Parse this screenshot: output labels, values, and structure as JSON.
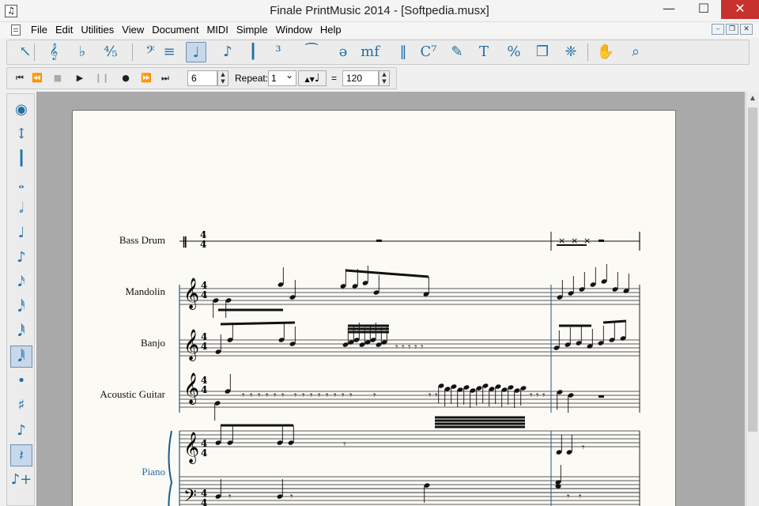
{
  "window": {
    "title": "Finale PrintMusic 2014 - [Softpedia.musx]",
    "minimize": "—",
    "maximize": "☐",
    "close": "✕"
  },
  "menu": {
    "items": [
      "File",
      "Edit",
      "Utilities",
      "View",
      "Document",
      "MIDI",
      "Simple",
      "Window",
      "Help"
    ],
    "mdi": [
      "–",
      "❐",
      "✕"
    ]
  },
  "toolbar": {
    "tools": [
      {
        "name": "selection-tool-icon",
        "glyph": "↖"
      },
      {
        "name": "staff-tool-icon",
        "glyph": "𝄞"
      },
      {
        "name": "key-signature-tool-icon",
        "glyph": "♭"
      },
      {
        "name": "time-signature-tool-icon",
        "glyph": "⅘"
      },
      {
        "name": "clef-tool-icon",
        "glyph": "𝄢"
      },
      {
        "name": "measure-tool-icon",
        "glyph": "≡"
      },
      {
        "name": "simple-entry-tool-icon",
        "glyph": "♩"
      },
      {
        "name": "speedy-entry-tool-icon",
        "glyph": "♪"
      },
      {
        "name": "tuplet-tool-icon",
        "glyph": "┃"
      },
      {
        "name": "triplet-tool-icon",
        "glyph": "³"
      },
      {
        "name": "smart-shape-tool-icon",
        "glyph": "⁀"
      },
      {
        "name": "articulation-tool-icon",
        "glyph": "ə"
      },
      {
        "name": "expression-tool-icon",
        "glyph": "mf"
      },
      {
        "name": "repeat-tool-icon",
        "glyph": "‖"
      },
      {
        "name": "chord-tool-icon",
        "glyph": "C⁷"
      },
      {
        "name": "lyrics-tool-icon",
        "glyph": "✎"
      },
      {
        "name": "text-tool-icon",
        "glyph": "T"
      },
      {
        "name": "resize-tool-icon",
        "glyph": "%"
      },
      {
        "name": "page-layout-tool-icon",
        "glyph": "❐"
      },
      {
        "name": "graphics-tool-icon",
        "glyph": "❈"
      },
      {
        "name": "hand-grabber-tool-icon",
        "glyph": "✋"
      },
      {
        "name": "zoom-tool-icon",
        "glyph": "⌕"
      }
    ]
  },
  "playback": {
    "buttons": [
      "⏮",
      "⏪",
      "■",
      "▶",
      "❙❙",
      "●",
      "⏩",
      "⏭"
    ],
    "measure": "6",
    "repeat_label": "Repeat:",
    "repeat_value": "1",
    "tempo_note": "♩",
    "equals": "=",
    "tempo": "120"
  },
  "palette": {
    "tools": [
      {
        "name": "eraser-icon",
        "glyph": "◉"
      },
      {
        "name": "tilt-mode-icon",
        "glyph": "↕"
      },
      {
        "name": "tuplet-palette-icon",
        "glyph": "┃"
      },
      {
        "name": "whole-note-icon",
        "glyph": "𝅝"
      },
      {
        "name": "half-note-icon",
        "glyph": "𝅗𝅥"
      },
      {
        "name": "quarter-note-icon",
        "glyph": "♩"
      },
      {
        "name": "eighth-note-icon",
        "glyph": "♪"
      },
      {
        "name": "sixteenth-note-icon",
        "glyph": "𝅘𝅥𝅯"
      },
      {
        "name": "thirty-second-note-icon",
        "glyph": "𝅘𝅥𝅰"
      },
      {
        "name": "sixty-fourth-note-icon",
        "glyph": "𝅘𝅥𝅱"
      },
      {
        "name": "one-twenty-eighth-note-icon",
        "glyph": "𝅘𝅥𝅲"
      },
      {
        "name": "dot-icon",
        "glyph": "•"
      },
      {
        "name": "sharp-icon",
        "glyph": "♯"
      },
      {
        "name": "grace-note-icon",
        "glyph": "♪"
      },
      {
        "name": "rest-icon",
        "glyph": "𝄽"
      },
      {
        "name": "add-note-icon",
        "glyph": "♪+"
      }
    ]
  },
  "score": {
    "staves": [
      "Bass Drum",
      "Mandolin",
      "Banjo",
      "Acoustic Guitar",
      "Piano"
    ],
    "time_signature": [
      "4",
      "4"
    ]
  }
}
